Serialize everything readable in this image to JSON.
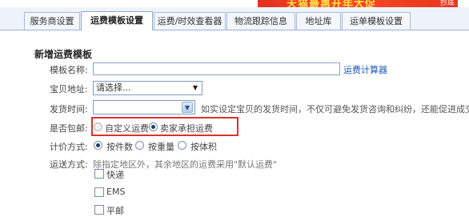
{
  "tabs": [
    {
      "label": "服务商设置",
      "active": false
    },
    {
      "label": "运费模板设置",
      "active": true
    },
    {
      "label": "运费/时效查看器",
      "active": false
    },
    {
      "label": "物流跟踪信息",
      "active": false
    },
    {
      "label": "地址库",
      "active": false
    },
    {
      "label": "运单模板设置",
      "active": false
    }
  ],
  "form": {
    "title": "新增运费模板",
    "template_name": {
      "label": "模板名称:",
      "value": "",
      "link": "运费计算器"
    },
    "ship_from": {
      "label": "宝贝地址:",
      "selected": "请选择..."
    },
    "ship_time": {
      "label": "发货时间:",
      "selected": "",
      "hint": "如实设定宝贝的发货时间，不仅可避免发货咨询和纠纷，还能促进成交! i"
    },
    "free_shipping": {
      "label": "是否包邮:",
      "options": [
        {
          "label": "自定义运费",
          "selected": false
        },
        {
          "label": "卖家承担运费",
          "selected": true
        }
      ]
    },
    "pricing": {
      "label": "计价方式:",
      "options": [
        {
          "label": "按件数",
          "selected": true
        },
        {
          "label": "按重量",
          "selected": false
        },
        {
          "label": "按体积",
          "selected": false
        }
      ]
    },
    "delivery": {
      "label": "运送方式:",
      "hint": "除指定地区外，其余地区的运费采用\"默认运费\"",
      "methods": [
        {
          "label": "快递",
          "checked": false
        },
        {
          "label": "EMS",
          "checked": false
        },
        {
          "label": "平邮",
          "checked": false
        }
      ]
    }
  },
  "banner": {
    "text": "天猫最惠开年大促",
    "corner": "抄底"
  },
  "colors": {
    "link": "#1d56b8",
    "highlight_box": "#d9342b",
    "tab_border": "#97b3d6"
  }
}
